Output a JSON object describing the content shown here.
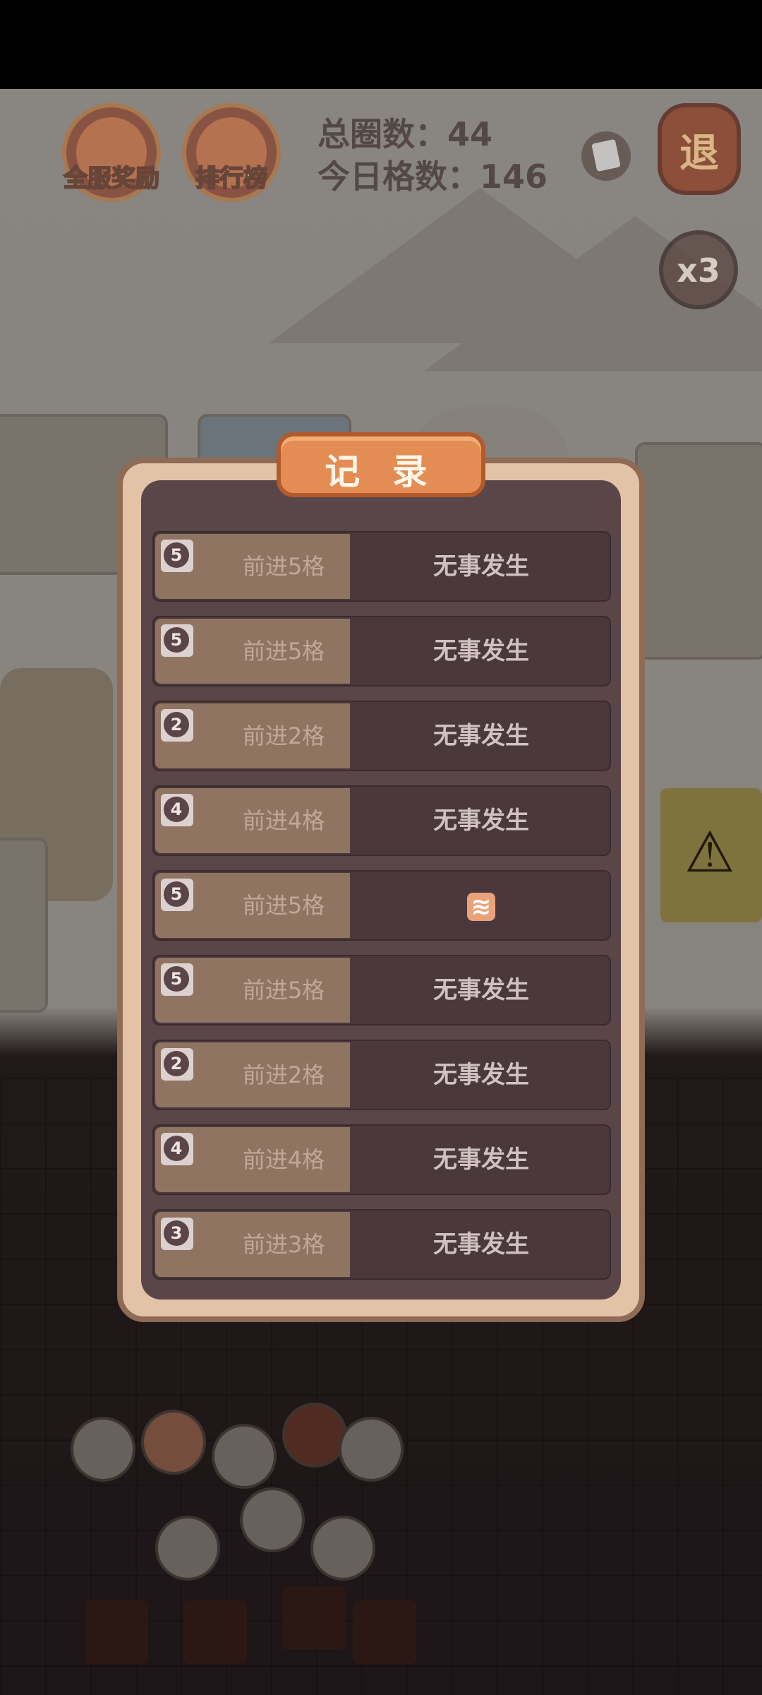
{
  "header": {
    "server_rewards_label": "全服奖励",
    "leaderboard_label": "排行榜",
    "total_laps_text": "总圈数：44",
    "today_steps_text": "今日格数：146",
    "exit_label": "退",
    "multiplier_label": "x3"
  },
  "record_panel": {
    "title": "记 录",
    "rows": [
      {
        "dice": "5",
        "move": "前进5格",
        "result": "无事发生"
      },
      {
        "dice": "5",
        "move": "前进5格",
        "result": "无事发生"
      },
      {
        "dice": "2",
        "move": "前进2格",
        "result": "无事发生"
      },
      {
        "dice": "4",
        "move": "前进4格",
        "result": "无事发生"
      },
      {
        "dice": "5",
        "move": "前进5格",
        "result": "",
        "result_icon": "wave-tile-icon"
      },
      {
        "dice": "5",
        "move": "前进5格",
        "result": "无事发生"
      },
      {
        "dice": "2",
        "move": "前进2格",
        "result": "无事发生"
      },
      {
        "dice": "4",
        "move": "前进4格",
        "result": "无事发生"
      },
      {
        "dice": "3",
        "move": "前进3格",
        "result": "无事发生"
      }
    ]
  },
  "colors": {
    "panel_border": "#8f6a55",
    "panel_bg": "#5a4548",
    "title_tab": "#e38d54"
  }
}
